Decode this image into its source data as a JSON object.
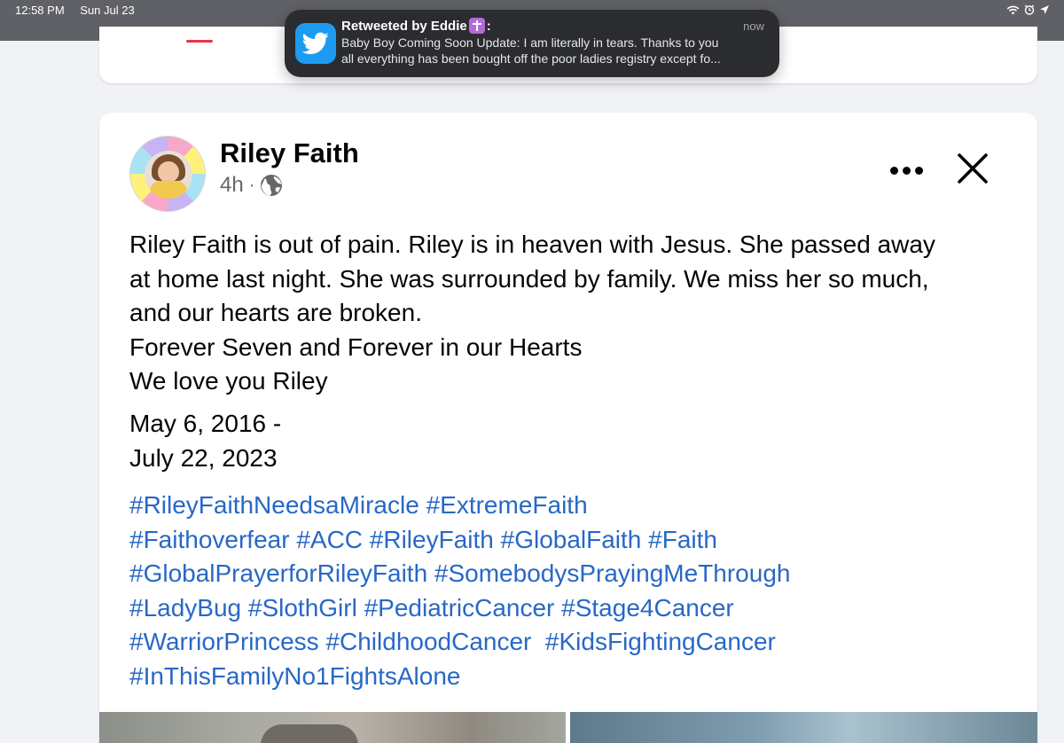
{
  "status_bar": {
    "time": "12:58 PM",
    "date": "Sun Jul 23",
    "icons": [
      "wifi-icon",
      "alarm-icon",
      "location-icon"
    ]
  },
  "notification": {
    "app_icon": "twitter-bird-icon",
    "title": "Retweeted by Eddie",
    "title_badge": "cross-emoji",
    "title_suffix": ":",
    "time": "now",
    "body_line1": "Baby Boy Coming Soon Update: I am literally in tears. Thanks to you",
    "body_line2": "all everything has been bought off the poor ladies registry except fo..."
  },
  "post": {
    "author": "Riley Faith",
    "time_ago": "4h",
    "separator": "·",
    "audience_icon": "globe-icon",
    "text_lines": [
      "Riley Faith is out of pain. Riley is in heaven with Jesus. She passed away",
      "at home last night. She was surrounded by family. We miss her so much,",
      "and our hearts are broken.",
      "Forever Seven and Forever in our Hearts",
      "We love you Riley"
    ],
    "date_lines": [
      "May 6, 2016 -",
      "July 22, 2023"
    ],
    "hashtag_lines": [
      "#RileyFaithNeedsaMiracle #ExtremeFaith",
      "#Faithoverfear #ACC #RileyFaith #GlobalFaith #Faith",
      "#GlobalPrayerforRileyFaith #SomebodysPrayingMeThrough",
      "#LadyBug #SlothGirl #PediatricCancer #Stage4Cancer",
      "#WarriorPrincess #ChildhoodCancer  #KidsFightingCancer",
      "#InThisFamilyNo1FightsAlone"
    ]
  },
  "colors": {
    "background": "#f0f2f5",
    "status_bar": "#5f6166",
    "notification_bg": "#2b2c2f",
    "twitter_blue": "#1d9bf0",
    "hashtag_blue": "#2868c6",
    "secondary_text": "#65676b"
  }
}
